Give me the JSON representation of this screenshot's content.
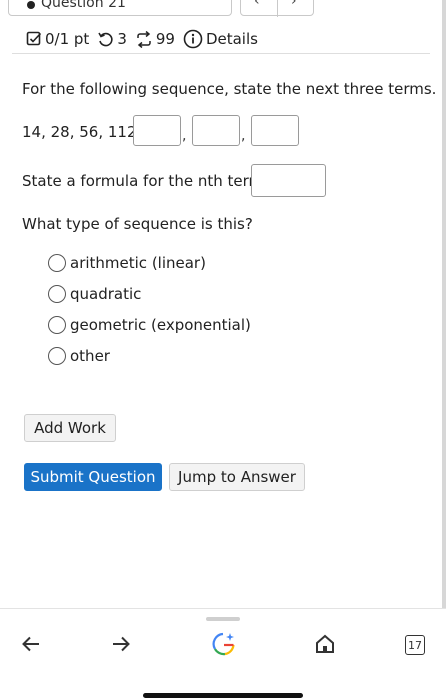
{
  "question": {
    "title": "Question 21"
  },
  "status": {
    "points": "0/1 pt",
    "retries": "3",
    "submissions": "99",
    "details_label": "Details"
  },
  "problem": {
    "prompt": "For the following sequence, state the next three terms.",
    "sequence": "14, 28, 56, 112,",
    "comma": ",",
    "formula_prompt": "State a formula for the nth term:",
    "type_prompt": "What type of sequence is this?",
    "options": [
      "arithmetic (linear)",
      "quadratic",
      "geometric (exponential)",
      "other"
    ]
  },
  "buttons": {
    "add_work": "Add Work",
    "submit": "Submit Question",
    "jump": "Jump to Answer"
  },
  "browser": {
    "tab_count": "17",
    "icons": [
      "back-arrow-icon",
      "forward-arrow-icon",
      "google-lens-icon",
      "home-icon",
      "tabs-icon"
    ]
  },
  "colors": {
    "primary": "#1a73c8"
  }
}
